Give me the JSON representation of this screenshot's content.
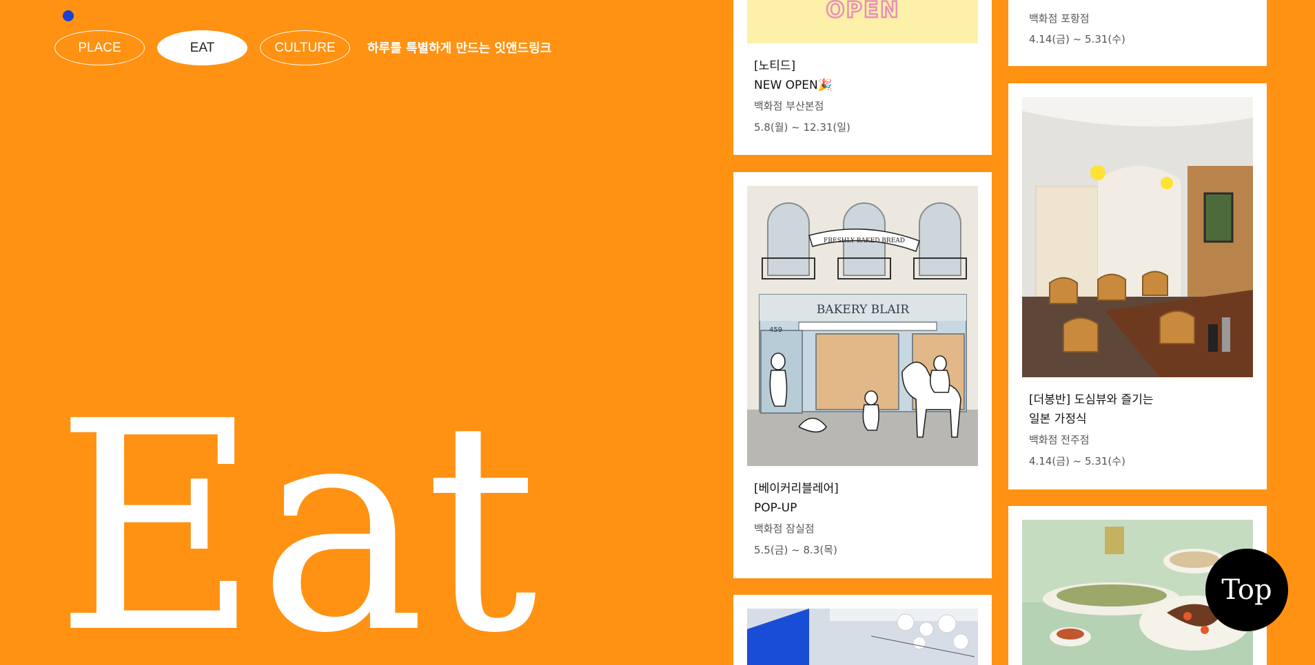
{
  "nav": {
    "items": [
      {
        "label": "PLACE",
        "active": false
      },
      {
        "label": "EAT",
        "active": true
      },
      {
        "label": "CULTURE",
        "active": false
      }
    ],
    "tagline": "하루를 특별하게 만드는 잇앤드링크"
  },
  "hero": {
    "title": "Eat"
  },
  "cards": {
    "c1": {
      "sign_text": "OPEN",
      "title_line1": "[노티드]",
      "title_line2": "NEW OPEN🎉",
      "store": "백화점 부산본점",
      "dates": "5.8(월) ~ 12.31(일)"
    },
    "c2": {
      "title_line1": "[베이커리블레어]",
      "title_line2": "POP-UP",
      "store": "백화점 잠실점",
      "dates": "5.5(금) ~ 8.3(목)",
      "banner_text": "FRESHLY BAKED BREAD",
      "shop_sign": "BAKERY BLAIR",
      "door_number": "459"
    },
    "c4": {
      "store": "백화점 포항점",
      "dates": "4.14(금) ~ 5.31(수)"
    },
    "c5": {
      "title_line1": "[더봉반] 도심뷰와 즐기는",
      "title_line2": "일본 가정식",
      "store": "백화점 전주점",
      "dates": "4.14(금) ~ 5.31(수)"
    }
  },
  "top_button": {
    "label": "Top"
  },
  "colors": {
    "background": "#ff9212",
    "accent_dot": "#1c3fd4",
    "card": "#ffffff",
    "top_button": "#000000"
  }
}
